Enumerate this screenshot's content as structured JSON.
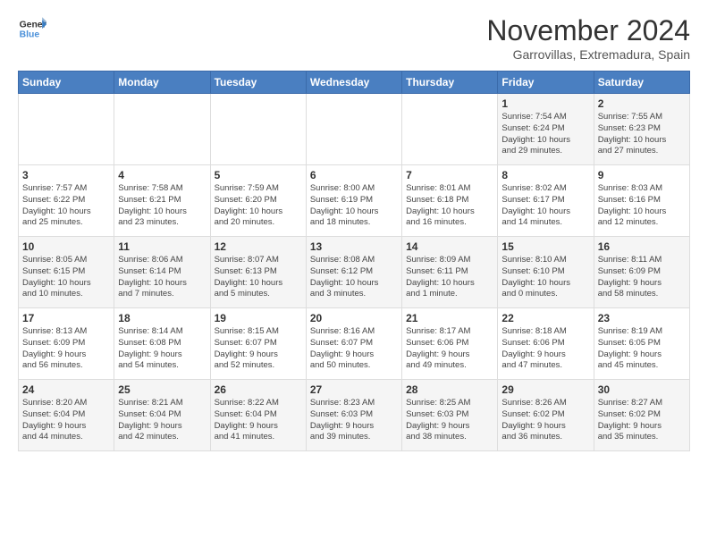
{
  "logo": {
    "line1": "General",
    "line2": "Blue"
  },
  "title": "November 2024",
  "subtitle": "Garrovillas, Extremadura, Spain",
  "days_of_week": [
    "Sunday",
    "Monday",
    "Tuesday",
    "Wednesday",
    "Thursday",
    "Friday",
    "Saturday"
  ],
  "weeks": [
    [
      {
        "day": "",
        "info": ""
      },
      {
        "day": "",
        "info": ""
      },
      {
        "day": "",
        "info": ""
      },
      {
        "day": "",
        "info": ""
      },
      {
        "day": "",
        "info": ""
      },
      {
        "day": "1",
        "info": "Sunrise: 7:54 AM\nSunset: 6:24 PM\nDaylight: 10 hours\nand 29 minutes."
      },
      {
        "day": "2",
        "info": "Sunrise: 7:55 AM\nSunset: 6:23 PM\nDaylight: 10 hours\nand 27 minutes."
      }
    ],
    [
      {
        "day": "3",
        "info": "Sunrise: 7:57 AM\nSunset: 6:22 PM\nDaylight: 10 hours\nand 25 minutes."
      },
      {
        "day": "4",
        "info": "Sunrise: 7:58 AM\nSunset: 6:21 PM\nDaylight: 10 hours\nand 23 minutes."
      },
      {
        "day": "5",
        "info": "Sunrise: 7:59 AM\nSunset: 6:20 PM\nDaylight: 10 hours\nand 20 minutes."
      },
      {
        "day": "6",
        "info": "Sunrise: 8:00 AM\nSunset: 6:19 PM\nDaylight: 10 hours\nand 18 minutes."
      },
      {
        "day": "7",
        "info": "Sunrise: 8:01 AM\nSunset: 6:18 PM\nDaylight: 10 hours\nand 16 minutes."
      },
      {
        "day": "8",
        "info": "Sunrise: 8:02 AM\nSunset: 6:17 PM\nDaylight: 10 hours\nand 14 minutes."
      },
      {
        "day": "9",
        "info": "Sunrise: 8:03 AM\nSunset: 6:16 PM\nDaylight: 10 hours\nand 12 minutes."
      }
    ],
    [
      {
        "day": "10",
        "info": "Sunrise: 8:05 AM\nSunset: 6:15 PM\nDaylight: 10 hours\nand 10 minutes."
      },
      {
        "day": "11",
        "info": "Sunrise: 8:06 AM\nSunset: 6:14 PM\nDaylight: 10 hours\nand 7 minutes."
      },
      {
        "day": "12",
        "info": "Sunrise: 8:07 AM\nSunset: 6:13 PM\nDaylight: 10 hours\nand 5 minutes."
      },
      {
        "day": "13",
        "info": "Sunrise: 8:08 AM\nSunset: 6:12 PM\nDaylight: 10 hours\nand 3 minutes."
      },
      {
        "day": "14",
        "info": "Sunrise: 8:09 AM\nSunset: 6:11 PM\nDaylight: 10 hours\nand 1 minute."
      },
      {
        "day": "15",
        "info": "Sunrise: 8:10 AM\nSunset: 6:10 PM\nDaylight: 10 hours\nand 0 minutes."
      },
      {
        "day": "16",
        "info": "Sunrise: 8:11 AM\nSunset: 6:09 PM\nDaylight: 9 hours\nand 58 minutes."
      }
    ],
    [
      {
        "day": "17",
        "info": "Sunrise: 8:13 AM\nSunset: 6:09 PM\nDaylight: 9 hours\nand 56 minutes."
      },
      {
        "day": "18",
        "info": "Sunrise: 8:14 AM\nSunset: 6:08 PM\nDaylight: 9 hours\nand 54 minutes."
      },
      {
        "day": "19",
        "info": "Sunrise: 8:15 AM\nSunset: 6:07 PM\nDaylight: 9 hours\nand 52 minutes."
      },
      {
        "day": "20",
        "info": "Sunrise: 8:16 AM\nSunset: 6:07 PM\nDaylight: 9 hours\nand 50 minutes."
      },
      {
        "day": "21",
        "info": "Sunrise: 8:17 AM\nSunset: 6:06 PM\nDaylight: 9 hours\nand 49 minutes."
      },
      {
        "day": "22",
        "info": "Sunrise: 8:18 AM\nSunset: 6:06 PM\nDaylight: 9 hours\nand 47 minutes."
      },
      {
        "day": "23",
        "info": "Sunrise: 8:19 AM\nSunset: 6:05 PM\nDaylight: 9 hours\nand 45 minutes."
      }
    ],
    [
      {
        "day": "24",
        "info": "Sunrise: 8:20 AM\nSunset: 6:04 PM\nDaylight: 9 hours\nand 44 minutes."
      },
      {
        "day": "25",
        "info": "Sunrise: 8:21 AM\nSunset: 6:04 PM\nDaylight: 9 hours\nand 42 minutes."
      },
      {
        "day": "26",
        "info": "Sunrise: 8:22 AM\nSunset: 6:04 PM\nDaylight: 9 hours\nand 41 minutes."
      },
      {
        "day": "27",
        "info": "Sunrise: 8:23 AM\nSunset: 6:03 PM\nDaylight: 9 hours\nand 39 minutes."
      },
      {
        "day": "28",
        "info": "Sunrise: 8:25 AM\nSunset: 6:03 PM\nDaylight: 9 hours\nand 38 minutes."
      },
      {
        "day": "29",
        "info": "Sunrise: 8:26 AM\nSunset: 6:02 PM\nDaylight: 9 hours\nand 36 minutes."
      },
      {
        "day": "30",
        "info": "Sunrise: 8:27 AM\nSunset: 6:02 PM\nDaylight: 9 hours\nand 35 minutes."
      }
    ]
  ]
}
